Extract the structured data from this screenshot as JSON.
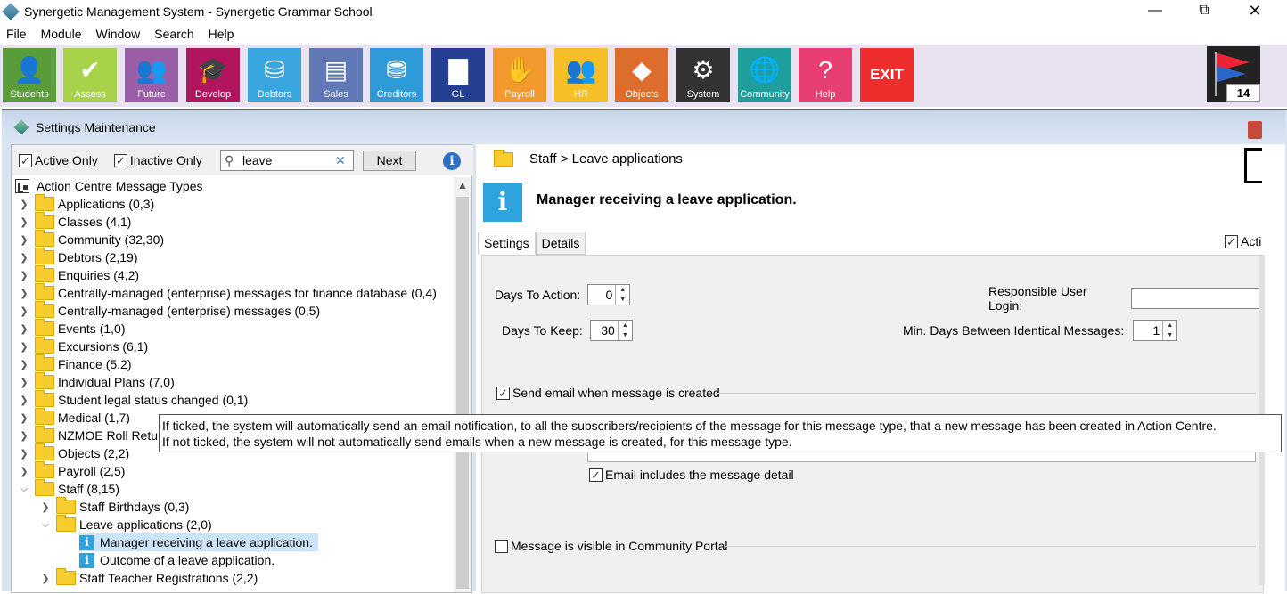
{
  "window": {
    "title": "Synergetic Management System - Synergetic Grammar School",
    "controls": {
      "minimize": "—",
      "maximize": "⧉",
      "close": "✕"
    }
  },
  "menu": [
    "File",
    "Module",
    "Window",
    "Search",
    "Help"
  ],
  "toolbar": {
    "buttons": [
      {
        "label": "Students",
        "icon": "student-icon",
        "glyph": "👤",
        "color": "#5a9c3a"
      },
      {
        "label": "Assess",
        "icon": "checkmark-icon",
        "glyph": "✔",
        "color": "#a8d24a"
      },
      {
        "label": "Future",
        "icon": "people-plus-icon",
        "glyph": "👥",
        "color": "#9a5fa6"
      },
      {
        "label": "Develop",
        "icon": "mortarboard-icon",
        "glyph": "🎓",
        "color": "#b0155e"
      },
      {
        "label": "Debtors",
        "icon": "coins-icon",
        "glyph": "⛁",
        "color": "#3aa6e0"
      },
      {
        "label": "Sales",
        "icon": "cash-register-icon",
        "glyph": "▤",
        "color": "#6079b6"
      },
      {
        "label": "Creditors",
        "icon": "coins-arrow-icon",
        "glyph": "⛃",
        "color": "#2f9ad8"
      },
      {
        "label": "GL",
        "icon": "bar-chart-icon",
        "glyph": "▇",
        "color": "#253f92"
      },
      {
        "label": "Payroll",
        "icon": "handshake-icon",
        "glyph": "✋",
        "color": "#f39a2f"
      },
      {
        "label": "HR",
        "icon": "group-icon",
        "glyph": "👥",
        "color": "#f6be27"
      },
      {
        "label": "Objects",
        "icon": "shapes-icon",
        "glyph": "◆",
        "color": "#dd6d2d"
      },
      {
        "label": "System",
        "icon": "gear-icon",
        "glyph": "⚙",
        "color": "#333333"
      },
      {
        "label": "Community",
        "icon": "globe-icon",
        "glyph": "🌐",
        "color": "#1e9e9c"
      },
      {
        "label": "Help",
        "icon": "question-icon",
        "glyph": "?",
        "color": "#e83f73"
      },
      {
        "label": "EXIT",
        "icon": "exit-icon",
        "glyph": "",
        "color": "#ee2d2d"
      }
    ],
    "flag_count": "14"
  },
  "inner": {
    "title": "Settings Maintenance"
  },
  "filter": {
    "active_only": "Active Only",
    "inactive_only": "Inactive Only",
    "search_value": "leave",
    "next": "Next"
  },
  "tree": {
    "root": "Action Centre Message Types",
    "items": [
      {
        "label": "Applications (0,3)"
      },
      {
        "label": "Classes (4,1)"
      },
      {
        "label": "Community (32,30)"
      },
      {
        "label": "Debtors (2,19)"
      },
      {
        "label": "Enquiries (4,2)"
      },
      {
        "label": "Centrally-managed (enterprise) messages for finance database (0,4)"
      },
      {
        "label": "Centrally-managed (enterprise) messages (0,5)"
      },
      {
        "label": "Events (1,0)"
      },
      {
        "label": "Excursions (6,1)"
      },
      {
        "label": "Finance (5,2)"
      },
      {
        "label": "Individual Plans (7,0)"
      },
      {
        "label": "Student legal status changed (0,1)"
      },
      {
        "label": "Medical (1,7)"
      },
      {
        "label": "NZMOE Roll Return"
      },
      {
        "label": "Objects (2,2)"
      },
      {
        "label": "Payroll (2,5)"
      },
      {
        "label": "Staff (8,15)"
      }
    ],
    "staff_children": [
      {
        "label": "Staff Birthdays (0,3)"
      },
      {
        "label": "Leave applications (2,0)"
      }
    ],
    "leave_children": [
      {
        "label": "Manager receiving a leave application."
      },
      {
        "label": "Outcome of a leave application."
      }
    ],
    "after": [
      {
        "label": "Staff Teacher Registrations (2,2)"
      }
    ]
  },
  "detail": {
    "breadcrumb": "Staff > Leave applications",
    "title": "Manager receiving a leave application.",
    "tabs": [
      "Settings",
      "Details"
    ],
    "active_label": "Acti",
    "days_to_action_label": "Days To Action:",
    "days_to_action": "0",
    "days_to_keep_label": "Days To Keep:",
    "days_to_keep": "30",
    "responsible_label": "Responsible User Login:",
    "responsible_value": "",
    "min_days_label": "Min. Days Between Identical Messages:",
    "min_days": "1",
    "send_email_label": "Send email when message is created",
    "email_detail_label": "Email includes the message detail",
    "portal_label": "Message is visible in Community Portal"
  },
  "tooltip": {
    "line1": "If ticked, the system will automatically send an email notification, to all the subscribers/recipients of the message for this message type, that a new message has been created in Action Centre.",
    "line2": "If not ticked, the system will not automatically send emails when a new message is created, for this message type."
  }
}
